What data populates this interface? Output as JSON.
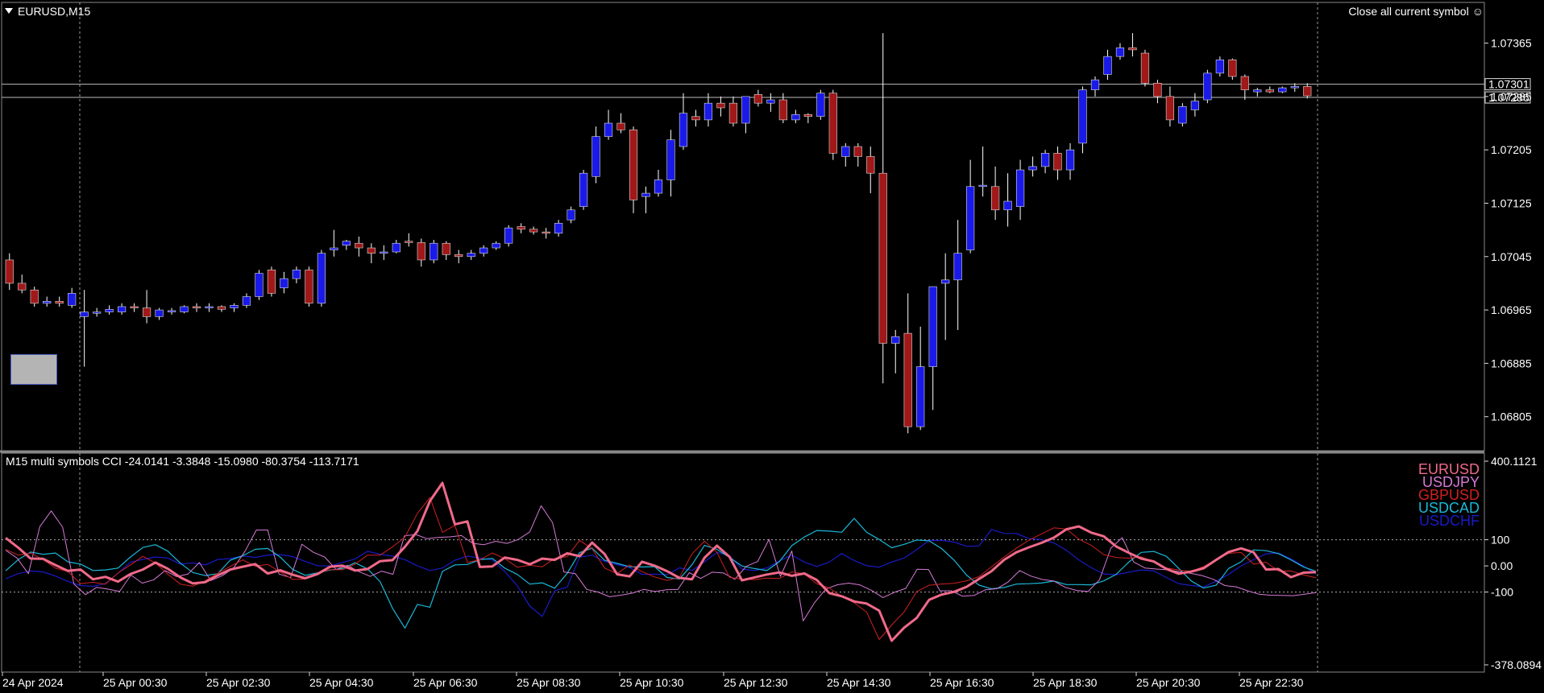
{
  "header": {
    "symbol_title": "EURUSD,M15",
    "close_button_label": "Close all current symbol",
    "close_button_icon": "smiley-icon"
  },
  "indicator": {
    "title": "M15 multi symbols CCI -24.0141 -3.3848 -15.0980 -80.3754 -113.7171",
    "legend": [
      {
        "symbol": "EURUSD",
        "color": "#f06a8a"
      },
      {
        "symbol": "USDJPY",
        "color": "#d67ad6"
      },
      {
        "symbol": "GBPUSD",
        "color": "#d02020"
      },
      {
        "symbol": "USDCAD",
        "color": "#1ab8d8"
      },
      {
        "symbol": "USDCHF",
        "color": "#1a1ac8"
      }
    ]
  },
  "chart_data": [
    {
      "type": "candlestick",
      "symbol": "EURUSD",
      "timeframe": "M15",
      "ylim": [
        1.0676,
        1.0742
      ],
      "y_ticks": [
        "1.07365",
        "1.07285",
        "1.07205",
        "1.07125",
        "1.07045",
        "1.06965",
        "1.06885",
        "1.06805"
      ],
      "y_tick_values": [
        1.07365,
        1.07285,
        1.07205,
        1.07125,
        1.07045,
        1.06965,
        1.06885,
        1.06805
      ],
      "horizontal_levels": [
        {
          "label": "1.07301",
          "value": 1.07301
        },
        {
          "label": "1.07286",
          "value": 1.07286
        }
      ],
      "colors": {
        "bull": "#1a1ae8",
        "bear": "#a01818",
        "wick": "#ffffff"
      },
      "x_ticks": [
        "24 Apr 2024",
        "25 Apr 00:30",
        "25 Apr 02:30",
        "25 Apr 04:30",
        "25 Apr 06:30",
        "25 Apr 08:30",
        "25 Apr 10:30",
        "25 Apr 12:30",
        "25 Apr 14:30",
        "25 Apr 16:30",
        "25 Apr 18:30",
        "25 Apr 20:30",
        "25 Apr 22:30"
      ],
      "candles": [
        [
          1.0704,
          1.0705,
          1.06995,
          1.07005
        ],
        [
          1.07005,
          1.07018,
          1.0699,
          1.06995
        ],
        [
          1.06995,
          1.07,
          1.0697,
          1.06975
        ],
        [
          1.06975,
          1.06985,
          1.0697,
          1.06978
        ],
        [
          1.06978,
          1.06985,
          1.0697,
          1.06975
        ],
        [
          1.06972,
          1.06998,
          1.06968,
          1.0699
        ],
        [
          1.06955,
          1.06995,
          1.0688,
          1.06962
        ],
        [
          1.0696,
          1.06968,
          1.06955,
          1.06962
        ],
        [
          1.06962,
          1.06972,
          1.06958,
          1.06966
        ],
        [
          1.06962,
          1.06975,
          1.06958,
          1.0697
        ],
        [
          1.0697,
          1.06975,
          1.06962,
          1.06968
        ],
        [
          1.06968,
          1.06995,
          1.06945,
          1.06955
        ],
        [
          1.06955,
          1.06968,
          1.0695,
          1.06965
        ],
        [
          1.06962,
          1.06968,
          1.06958,
          1.06964
        ],
        [
          1.06962,
          1.06972,
          1.0696,
          1.0697
        ],
        [
          1.0697,
          1.06975,
          1.06962,
          1.06968
        ],
        [
          1.06968,
          1.06975,
          1.06962,
          1.0697
        ],
        [
          1.0697,
          1.06972,
          1.06962,
          1.06966
        ],
        [
          1.06968,
          1.06975,
          1.06962,
          1.06972
        ],
        [
          1.06972,
          1.0699,
          1.06968,
          1.06985
        ],
        [
          1.06985,
          1.07025,
          1.0698,
          1.0702
        ],
        [
          1.07025,
          1.0703,
          1.06985,
          1.0699
        ],
        [
          1.06998,
          1.07022,
          1.0699,
          1.07012
        ],
        [
          1.07012,
          1.0703,
          1.07005,
          1.07025
        ],
        [
          1.07025,
          1.0703,
          1.0697,
          1.06975
        ],
        [
          1.06975,
          1.07055,
          1.0697,
          1.0705
        ],
        [
          1.07055,
          1.07085,
          1.07045,
          1.07058
        ],
        [
          1.07062,
          1.0707,
          1.07055,
          1.07068
        ],
        [
          1.07065,
          1.07075,
          1.07045,
          1.07058
        ],
        [
          1.07058,
          1.07065,
          1.07035,
          1.0705
        ],
        [
          1.0705,
          1.07062,
          1.0704,
          1.07052
        ],
        [
          1.07052,
          1.0707,
          1.0705,
          1.07065
        ],
        [
          1.07068,
          1.0708,
          1.0706,
          1.07066
        ],
        [
          1.07066,
          1.07072,
          1.0703,
          1.0704
        ],
        [
          1.0704,
          1.0707,
          1.07035,
          1.07065
        ],
        [
          1.07065,
          1.07068,
          1.0704,
          1.07048
        ],
        [
          1.07048,
          1.07055,
          1.07035,
          1.07045
        ],
        [
          1.07045,
          1.07055,
          1.0704,
          1.0705
        ],
        [
          1.0705,
          1.07062,
          1.07045,
          1.07058
        ],
        [
          1.07058,
          1.07068,
          1.07055,
          1.07065
        ],
        [
          1.07065,
          1.07092,
          1.0706,
          1.07088
        ],
        [
          1.0709,
          1.07095,
          1.0708,
          1.07086
        ],
        [
          1.07086,
          1.0709,
          1.07078,
          1.07082
        ],
        [
          1.07082,
          1.07088,
          1.07072,
          1.0708
        ],
        [
          1.0708,
          1.071,
          1.07075,
          1.07095
        ],
        [
          1.071,
          1.0712,
          1.07095,
          1.07115
        ],
        [
          1.0712,
          1.07175,
          1.07115,
          1.0717
        ],
        [
          1.07165,
          1.0724,
          1.07155,
          1.07225
        ],
        [
          1.07225,
          1.07265,
          1.0722,
          1.07245
        ],
        [
          1.07245,
          1.0726,
          1.0723,
          1.07235
        ],
        [
          1.07235,
          1.0724,
          1.0711,
          1.0713
        ],
        [
          1.07135,
          1.0715,
          1.0711,
          1.0714
        ],
        [
          1.0714,
          1.07175,
          1.07135,
          1.0716
        ],
        [
          1.0716,
          1.07235,
          1.07135,
          1.0722
        ],
        [
          1.0721,
          1.0729,
          1.07205,
          1.0726
        ],
        [
          1.07255,
          1.07265,
          1.0724,
          1.0725
        ],
        [
          1.0725,
          1.0729,
          1.0724,
          1.07275
        ],
        [
          1.07275,
          1.07285,
          1.07255,
          1.07268
        ],
        [
          1.07275,
          1.07285,
          1.0724,
          1.07245
        ],
        [
          1.07245,
          1.07285,
          1.0723,
          1.07285
        ],
        [
          1.07288,
          1.07295,
          1.0727,
          1.07275
        ],
        [
          1.07275,
          1.0729,
          1.07262,
          1.0728
        ],
        [
          1.0728,
          1.0729,
          1.07245,
          1.0725
        ],
        [
          1.0725,
          1.07265,
          1.07245,
          1.07258
        ],
        [
          1.07258,
          1.0726,
          1.07245,
          1.07255
        ],
        [
          1.07255,
          1.07295,
          1.0725,
          1.0729
        ],
        [
          1.0729,
          1.07295,
          1.0719,
          1.072
        ],
        [
          1.07195,
          1.07215,
          1.0718,
          1.0721
        ],
        [
          1.0721,
          1.07215,
          1.0718,
          1.07195
        ],
        [
          1.07195,
          1.0721,
          1.0714,
          1.0717
        ],
        [
          1.0717,
          1.0738,
          1.06855,
          1.06915
        ],
        [
          1.06915,
          1.06935,
          1.0687,
          1.06925
        ],
        [
          1.0693,
          1.0699,
          1.0678,
          1.0679
        ],
        [
          1.0679,
          1.0694,
          1.06785,
          1.0688
        ],
        [
          1.0688,
          1.07,
          1.06815,
          1.07
        ],
        [
          1.07005,
          1.0705,
          1.0692,
          1.0701
        ],
        [
          1.0701,
          1.071,
          1.06935,
          1.0705
        ],
        [
          1.07055,
          1.0719,
          1.0705,
          1.0715
        ],
        [
          1.0715,
          1.0721,
          1.07135,
          1.07152
        ],
        [
          1.0715,
          1.0718,
          1.071,
          1.07115
        ],
        [
          1.07115,
          1.0717,
          1.0709,
          1.07128
        ],
        [
          1.0712,
          1.0719,
          1.071,
          1.07175
        ],
        [
          1.07175,
          1.07195,
          1.07165,
          1.0718
        ],
        [
          1.0718,
          1.07205,
          1.0717,
          1.072
        ],
        [
          1.072,
          1.0721,
          1.0716,
          1.07175
        ],
        [
          1.07175,
          1.07215,
          1.0716,
          1.07205
        ],
        [
          1.07215,
          1.073,
          1.072,
          1.07295
        ],
        [
          1.07295,
          1.07315,
          1.07285,
          1.0731
        ],
        [
          1.07318,
          1.07355,
          1.0731,
          1.07345
        ],
        [
          1.07345,
          1.07365,
          1.0734,
          1.07358
        ],
        [
          1.07358,
          1.0738,
          1.07345,
          1.07355
        ],
        [
          1.0735,
          1.07355,
          1.073,
          1.07305
        ],
        [
          1.07305,
          1.0731,
          1.07275,
          1.07285
        ],
        [
          1.07285,
          1.073,
          1.0724,
          1.0725
        ],
        [
          1.07245,
          1.07275,
          1.0724,
          1.0727
        ],
        [
          1.07265,
          1.0729,
          1.07255,
          1.07278
        ],
        [
          1.0728,
          1.07325,
          1.07275,
          1.0732
        ],
        [
          1.0732,
          1.07345,
          1.07315,
          1.0734
        ],
        [
          1.0734,
          1.07342,
          1.0731,
          1.07315
        ],
        [
          1.07315,
          1.07318,
          1.0728,
          1.07295
        ],
        [
          1.07292,
          1.07298,
          1.07285,
          1.07295
        ],
        [
          1.07295,
          1.073,
          1.0729,
          1.07292
        ],
        [
          1.07292,
          1.073,
          1.0729,
          1.07298
        ],
        [
          1.07298,
          1.07305,
          1.07292,
          1.073
        ],
        [
          1.073,
          1.07305,
          1.07282,
          1.07286
        ]
      ]
    },
    {
      "type": "line",
      "title": "M15 multi symbols CCI",
      "ylim": [
        -378.0894,
        400.1121
      ],
      "y_ticks": [
        "400.1121",
        "100",
        "0.00",
        "-100",
        "-378.0894"
      ],
      "y_tick_values": [
        400.1121,
        100,
        0,
        -100,
        -378.0894
      ],
      "reference_levels": [
        100,
        -100
      ],
      "series": [
        {
          "name": "EURUSD",
          "color": "#f06a8a",
          "width": 3,
          "values": [
            107,
            70,
            28,
            27,
            3,
            -19,
            -14,
            -51,
            -42,
            -60,
            -31,
            -14,
            13,
            -11,
            -44,
            -67,
            -62,
            -36,
            -14,
            -3,
            7,
            -29,
            -17,
            -34,
            -47,
            -31,
            -3,
            1,
            -18,
            -12,
            18,
            22,
            73,
            133,
            248,
            317,
            159,
            170,
            -4,
            -2,
            32,
            23,
            6,
            28,
            23,
            48,
            37,
            89,
            45,
            -32,
            -40,
            16,
            1,
            -20,
            -46,
            -51,
            31,
            77,
            35,
            -55,
            -44,
            -33,
            -25,
            -38,
            -29,
            -54,
            -104,
            -116,
            -136,
            -144,
            -171,
            -286,
            -236,
            -199,
            -130,
            -110,
            -99,
            -80,
            -50,
            -20,
            23,
            52,
            71,
            88,
            108,
            140,
            151,
            127,
            113,
            74,
            50,
            28,
            17,
            -11,
            -30,
            -22,
            -9,
            23,
            53,
            67,
            52,
            -14,
            -12,
            -43,
            -26,
            -24
          ]
        },
        {
          "name": "USDJPY",
          "color": "#d67ad6",
          "width": 1,
          "values": [
            60,
            30,
            -30,
            150,
            210,
            148,
            -70,
            -110,
            -82,
            -89,
            -98,
            -35,
            -66,
            -53,
            -18,
            -41,
            -31,
            13,
            -56,
            -38,
            -8,
            55,
            137,
            137,
            -31,
            -45,
            83,
            52,
            34,
            -14,
            2,
            -22,
            -40,
            -20,
            -32,
            115,
            120,
            104,
            109,
            111,
            116,
            86,
            81,
            94,
            86,
            101,
            130,
            230,
            165,
            -23,
            -30,
            -90,
            -100,
            -118,
            -112,
            -104,
            -90,
            -98,
            -91,
            -90,
            -26,
            -48,
            -24,
            -27,
            -51,
            -2,
            17,
            101,
            -40,
            57,
            -210,
            -140,
            -88,
            -72,
            -66,
            -73,
            -94,
            -121,
            -101,
            -86,
            -13,
            -14,
            -95,
            -95,
            -116,
            -113,
            -91,
            -87,
            -61,
            -18,
            -39,
            -52,
            -58,
            -82,
            -94,
            -98,
            -53,
            68,
            108,
            15,
            -8,
            -12,
            -15,
            -22,
            -28,
            -37,
            -51,
            -75,
            -80,
            -95,
            -108,
            -112,
            -113,
            -114,
            -108,
            -102
          ]
        }
      ]
    }
  ]
}
